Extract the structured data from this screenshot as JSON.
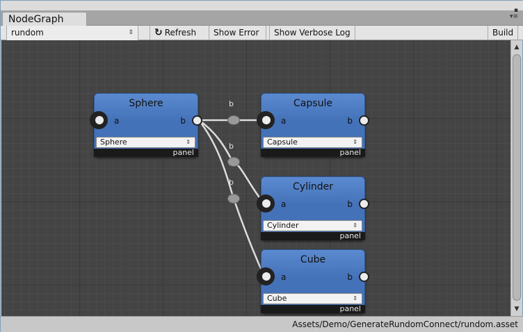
{
  "window": {
    "tab_title": "NodeGraph",
    "controls_label": "▪\n▾≡"
  },
  "toolbar": {
    "graph_select_value": "rundom",
    "select_arrows": "⇕",
    "refresh_icon": "↻",
    "refresh_label": "Refresh",
    "show_error_label": "Show Error",
    "show_verbose_label": "Show Verbose Log",
    "build_label": "Build"
  },
  "nodes": [
    {
      "title": "Sphere",
      "in_label": "a",
      "out_label": "b",
      "dropdown_value": "Sphere",
      "panel_label": "panel"
    },
    {
      "title": "Capsule",
      "in_label": "a",
      "out_label": "b",
      "dropdown_value": "Capsule",
      "panel_label": "panel"
    },
    {
      "title": "Cylinder",
      "in_label": "a",
      "out_label": "b",
      "dropdown_value": "Cylinder",
      "panel_label": "panel"
    },
    {
      "title": "Cube",
      "in_label": "a",
      "out_label": "b",
      "dropdown_value": "Cube",
      "panel_label": "panel"
    }
  ],
  "edges": [
    {
      "label": "b",
      "from": "Sphere",
      "to": "Capsule"
    },
    {
      "label": "b",
      "from": "Sphere",
      "to": "Cylinder"
    },
    {
      "label": "b",
      "from": "Sphere",
      "to": "Cube"
    }
  ],
  "dropdown_arrows": "⇕",
  "scrollbar": {
    "up": "▲",
    "down": "▼"
  },
  "status": {
    "asset_path": "Assets/Demo/GenerateRundomConnect/rundom.asset"
  },
  "colors": {
    "node_blue": "#4472b8",
    "canvas": "#444444",
    "edge": "#dddddd"
  }
}
